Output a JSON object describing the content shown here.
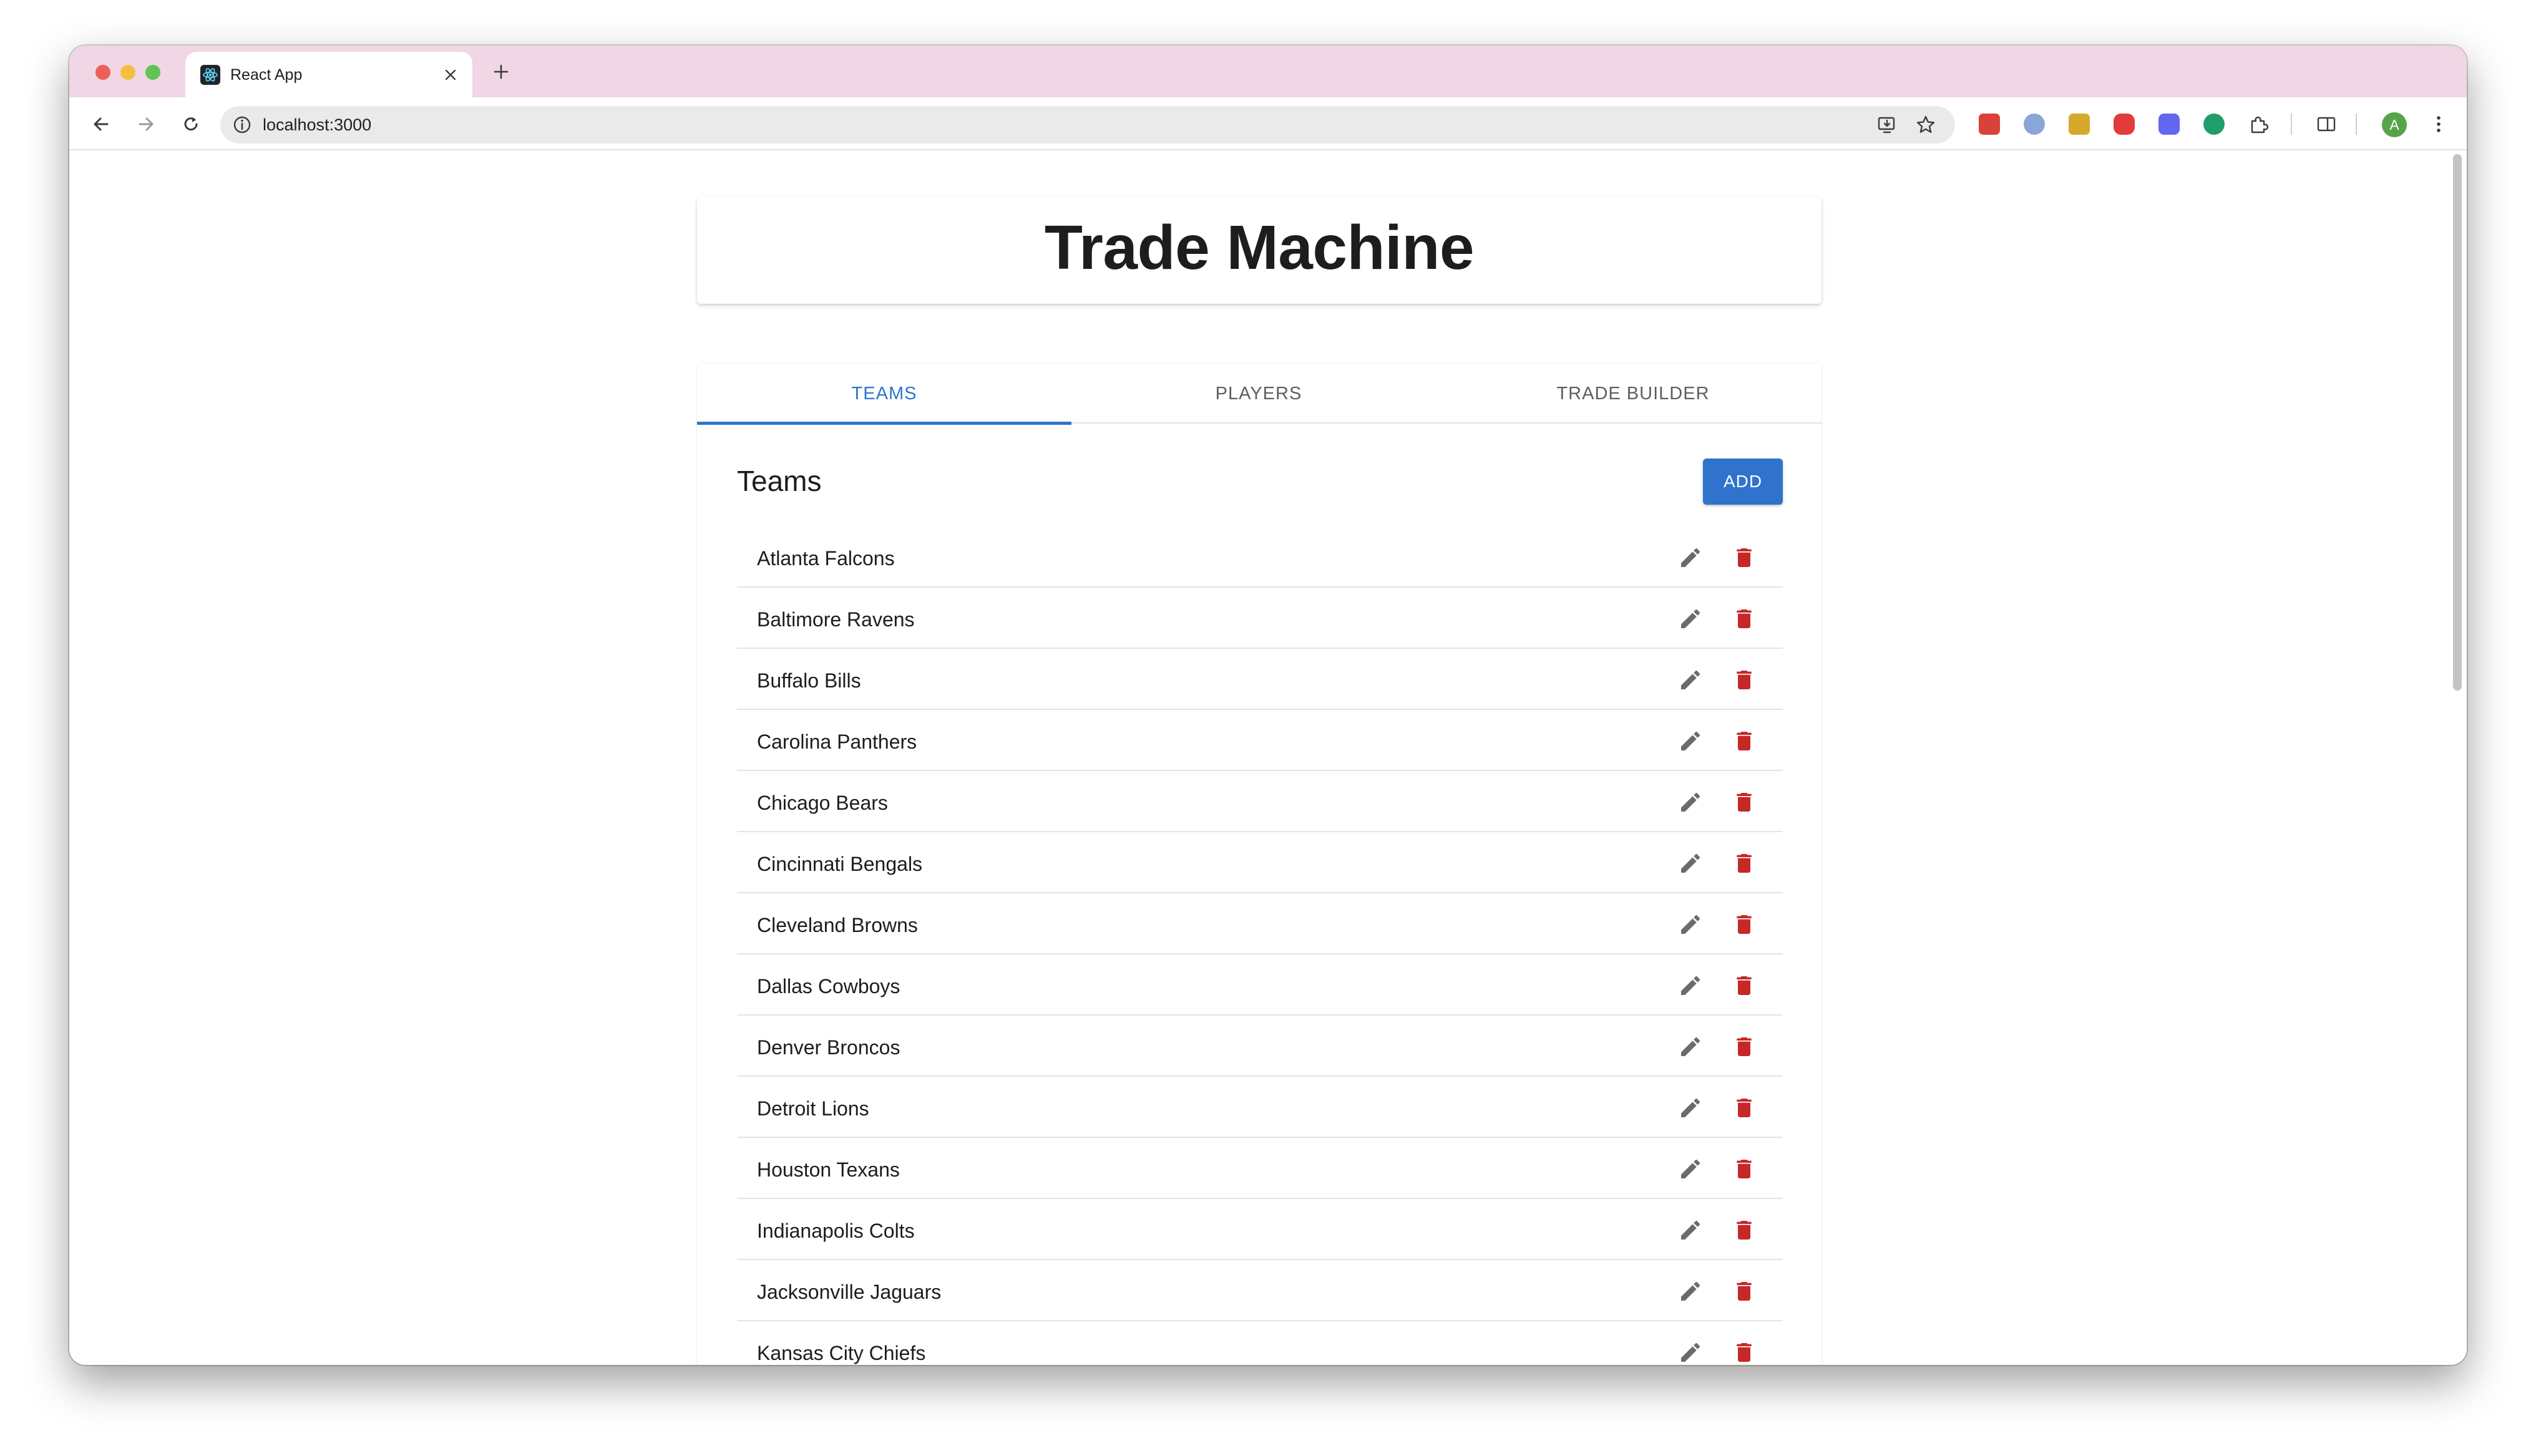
{
  "browser": {
    "tab_title": "React App",
    "url": "localhost:3000",
    "profile_initial": "A",
    "colors": {
      "tabstrip": "#f1d6e6",
      "close": "#ee5f57",
      "minimize": "#f5be3f",
      "zoom": "#5fc454"
    },
    "extensions": [
      "ext-red-icon",
      "ext-compass-icon",
      "ext-folder-icon",
      "ext-youtube-icon",
      "ext-purple-icon",
      "ext-grammarly-icon",
      "puzzle-icon"
    ]
  },
  "page": {
    "title": "Trade Machine",
    "tabs": [
      {
        "label": "TEAMS",
        "active": true
      },
      {
        "label": "PLAYERS",
        "active": false
      },
      {
        "label": "TRADE BUILDER",
        "active": false
      }
    ],
    "section_title": "Teams",
    "add_label": "ADD",
    "accent_color": "#2f73cc",
    "delete_color": "#c62828",
    "teams": [
      "Atlanta Falcons",
      "Baltimore Ravens",
      "Buffalo Bills",
      "Carolina Panthers",
      "Chicago Bears",
      "Cincinnati Bengals",
      "Cleveland Browns",
      "Dallas Cowboys",
      "Denver Broncos",
      "Detroit Lions",
      "Houston Texans",
      "Indianapolis Colts",
      "Jacksonville Jaguars",
      "Kansas City Chiefs"
    ]
  }
}
